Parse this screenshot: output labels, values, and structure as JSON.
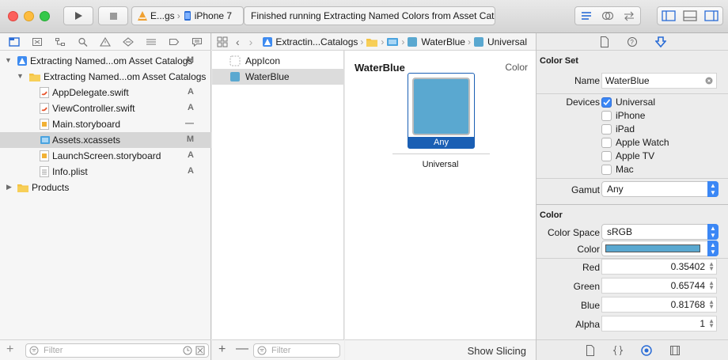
{
  "toolbar": {
    "scheme_label": "E...gs",
    "device_label": "iPhone 7",
    "activity_text": "Finished running Extracting Named Colors from Asset Cata"
  },
  "navigator": {
    "rows": [
      {
        "label": "Extracting Named...om Asset Catalogs",
        "badge": "M"
      },
      {
        "label": "Extracting Named...om Asset Catalogs",
        "badge": ""
      },
      {
        "label": "AppDelegate.swift",
        "badge": "A"
      },
      {
        "label": "ViewController.swift",
        "badge": "A"
      },
      {
        "label": "Main.storyboard",
        "badge": "—"
      },
      {
        "label": "Assets.xcassets",
        "badge": "M"
      },
      {
        "label": "LaunchScreen.storyboard",
        "badge": "A"
      },
      {
        "label": "Info.plist",
        "badge": "A"
      },
      {
        "label": "Products",
        "badge": ""
      }
    ],
    "filter_placeholder": "Filter"
  },
  "jumpbar": {
    "project": "Extractin...Catalogs",
    "color": "WaterBlue",
    "appearance": "Universal"
  },
  "assets": {
    "items": [
      "AppIcon",
      "WaterBlue"
    ],
    "filter_placeholder": "Filter"
  },
  "canvas": {
    "title": "WaterBlue",
    "kind": "Color",
    "slot_label": "Any",
    "device_label": "Universal",
    "show_slicing": "Show Slicing"
  },
  "inspector": {
    "color_set_title": "Color Set",
    "name_label": "Name",
    "name_value": "WaterBlue",
    "devices_label": "Devices",
    "devices": [
      {
        "label": "Universal",
        "checked": true
      },
      {
        "label": "iPhone",
        "checked": false
      },
      {
        "label": "iPad",
        "checked": false
      },
      {
        "label": "Apple Watch",
        "checked": false
      },
      {
        "label": "Apple TV",
        "checked": false
      },
      {
        "label": "Mac",
        "checked": false
      }
    ],
    "gamut_label": "Gamut",
    "gamut_value": "Any",
    "color_title": "Color",
    "color_space_label": "Color Space",
    "color_space_value": "sRGB",
    "color_label": "Color",
    "red_label": "Red",
    "red_value": "0.35402",
    "green_label": "Green",
    "green_value": "0.65744",
    "blue_label": "Blue",
    "blue_value": "0.81768",
    "alpha_label": "Alpha",
    "alpha_value": "1"
  },
  "colors": {
    "swatch": "#5aa8d0",
    "accent": "#3b87f5",
    "selection_bar": "#1a5fb4"
  }
}
